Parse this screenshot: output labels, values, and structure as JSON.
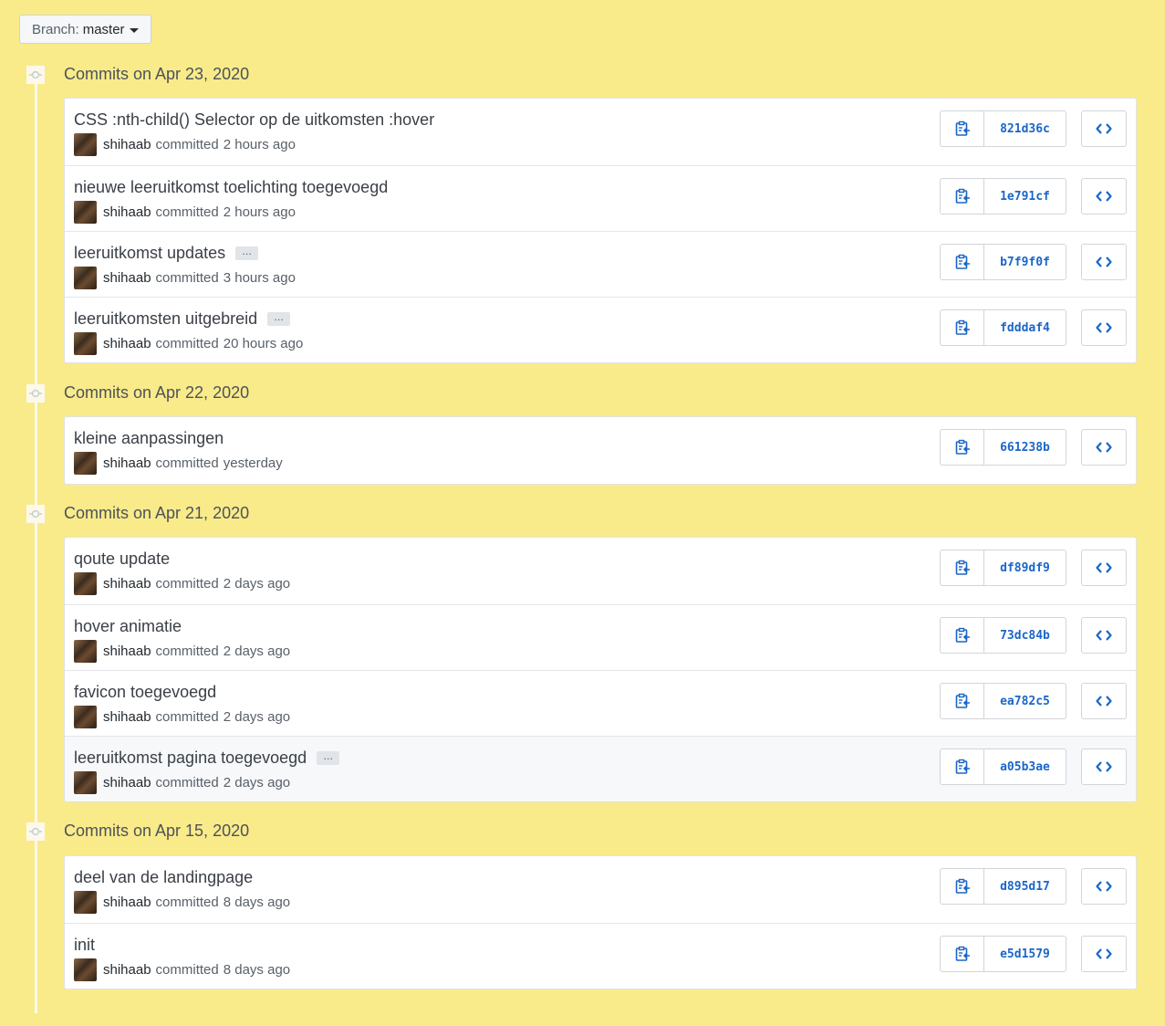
{
  "branch": {
    "label": "Branch:",
    "value": "master"
  },
  "groups": [
    {
      "title": "Commits on Apr 23, 2020",
      "commits": [
        {
          "message": "CSS :nth-child() Selector op de uitkomsten :hover",
          "author": "shihaab",
          "action": "committed",
          "time": "2 hours ago",
          "sha": "821d36c",
          "has_more": false,
          "highlighted": false
        },
        {
          "message": "nieuwe leeruitkomst toelichting toegevoegd",
          "author": "shihaab",
          "action": "committed",
          "time": "2 hours ago",
          "sha": "1e791cf",
          "has_more": false,
          "highlighted": false
        },
        {
          "message": "leeruitkomst updates",
          "author": "shihaab",
          "action": "committed",
          "time": "3 hours ago",
          "sha": "b7f9f0f",
          "has_more": true,
          "highlighted": false
        },
        {
          "message": "leeruitkomsten uitgebreid",
          "author": "shihaab",
          "action": "committed",
          "time": "20 hours ago",
          "sha": "fdddaf4",
          "has_more": true,
          "highlighted": false
        }
      ]
    },
    {
      "title": "Commits on Apr 22, 2020",
      "commits": [
        {
          "message": "kleine aanpassingen",
          "author": "shihaab",
          "action": "committed",
          "time": "yesterday",
          "sha": "661238b",
          "has_more": false,
          "highlighted": false
        }
      ]
    },
    {
      "title": "Commits on Apr 21, 2020",
      "commits": [
        {
          "message": "qoute update",
          "author": "shihaab",
          "action": "committed",
          "time": "2 days ago",
          "sha": "df89df9",
          "has_more": false,
          "highlighted": false
        },
        {
          "message": "hover animatie",
          "author": "shihaab",
          "action": "committed",
          "time": "2 days ago",
          "sha": "73dc84b",
          "has_more": false,
          "highlighted": false
        },
        {
          "message": "favicon toegevoegd",
          "author": "shihaab",
          "action": "committed",
          "time": "2 days ago",
          "sha": "ea782c5",
          "has_more": false,
          "highlighted": false
        },
        {
          "message": "leeruitkomst pagina toegevoegd",
          "author": "shihaab",
          "action": "committed",
          "time": "2 days ago",
          "sha": "a05b3ae",
          "has_more": true,
          "highlighted": true
        }
      ]
    },
    {
      "title": "Commits on Apr 15, 2020",
      "commits": [
        {
          "message": "deel van de landingpage",
          "author": "shihaab",
          "action": "committed",
          "time": "8 days ago",
          "sha": "d895d17",
          "has_more": false,
          "highlighted": false
        },
        {
          "message": "init",
          "author": "shihaab",
          "action": "committed",
          "time": "8 days ago",
          "sha": "e5d1579",
          "has_more": false,
          "highlighted": false
        }
      ]
    }
  ],
  "ellipsis_label": "…",
  "icons": {
    "commit_node": "git-commit-icon",
    "copy": "clipboard-icon",
    "browse": "code-icon",
    "branch_caret": "triangle-down-icon"
  },
  "colors": {
    "page_background": "#f9eb8a",
    "sha_link": "#1a66c8",
    "row_highlight": "#f6f8fa"
  }
}
